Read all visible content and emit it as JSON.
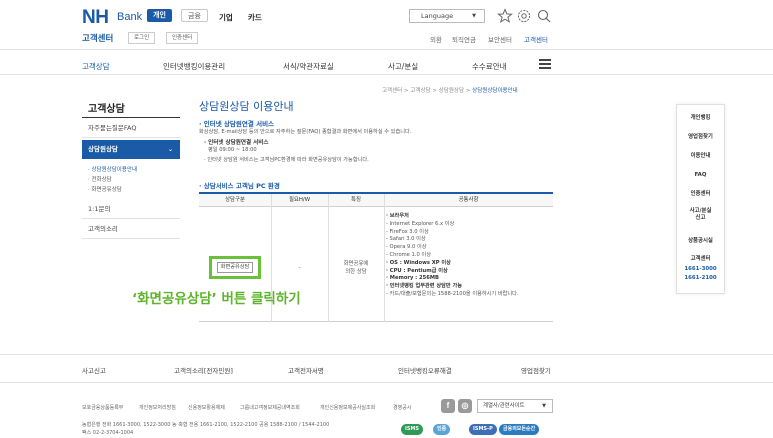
{
  "header": {
    "logo_nh": "NH",
    "logo_bank": "Bank",
    "segments": [
      "개인",
      "금융"
    ],
    "nav": [
      "기업",
      "카드"
    ],
    "language": "Language",
    "center_title": "고객센터",
    "login_btn": "로그인",
    "cert_btn": "인증센터",
    "top_links": [
      "외환",
      "퇴직연금",
      "보안센터",
      "고객센터"
    ]
  },
  "gnb": [
    "고객상담",
    "인터넷뱅킹이용관리",
    "서식/약관자료실",
    "사고/분실",
    "수수료안내"
  ],
  "breadcrumb": [
    "고객센터",
    "고객상담",
    "상담원상담",
    "상담원상담이용안내"
  ],
  "lnb": {
    "title": "고객상담",
    "items": [
      "자주묻는질문FAQ",
      "상담원상담",
      "1:1문의",
      "고객의소리"
    ],
    "subitems": [
      "상담원상담이용안내",
      "전화상담",
      "화면공유상담"
    ]
  },
  "main": {
    "title": "상담원상담 이용안내",
    "sec1": "인터넷 상담원연결 서비스",
    "sec1_desc": "화상상담, E-mail상담 등의 안으로 자주하는 질문(FAQ) 종합결과 화면에서 이용하실 수 있습니다.",
    "sec1_sub_title": "인터넷 상담원연결 서비스",
    "sec1_sub_hours": "평일 09:00 ~ 18:00",
    "sec1_note": "인터넷 상담원 서비스는 고객님PC환경에 따라 화면공유상담이 가능합니다.",
    "sec2": "상담서비스 고객님 PC 환경",
    "table_headers": [
      "상담구분",
      "필요H/W",
      "특징",
      "공통사항"
    ],
    "share_button": "화면공유상담",
    "hw": "-",
    "feature": "화면공유에\n의한 상담",
    "spec_lines": [
      "· 브라우저",
      "  - Internet Explorer 6.x 이상",
      "  - FireFox 3.0 이상",
      "  - Safari 3.0 이상",
      "  - Opera 9.0 이상",
      "  - Chrome 1.0 이상",
      "· OS : Windows XP 이상",
      "· CPU : Pentium급 이상",
      "· Memory : 256MB",
      "· 인터넷뱅킹 업무관련 상담만 가능",
      "  - 카드/대출/보험문의는 1588-2100을 이용하시기 바랍니다."
    ],
    "callout": "‘화면공유상담’ 버튼 클릭하기"
  },
  "quick_menu": [
    "개인뱅킹",
    "영업점찾기",
    "이용안내",
    "FAQ",
    "인증센터",
    "사고/분실\n신고",
    "상품공시실",
    "고객센터",
    "1661-3000",
    "1661-2100"
  ],
  "footer": {
    "nav": [
      "사고신고",
      "고객의소리[전자민원]",
      "고객전자서명",
      "인터넷뱅킹오류해결",
      "영업점찾기"
    ],
    "links": [
      "보호금융상품등록부",
      "개인정보처리방침",
      "신용정보활용체제",
      "그룹내고객정보제공내역조회",
      "개인신용정보제공사실조회",
      "경영공시"
    ],
    "site_select": "계열사/관련사이트",
    "info_line1": "농협은행 전화 1661-3000, 1522-3000   농 축협 전용 1661-2100, 1522-2100   공용 1588-2100 / 1544-2100",
    "info_line2": "팩스 02-2-3704-1004",
    "badges": [
      "ISMS",
      "인증",
      "ISMS-P",
      "금융의모든순간"
    ]
  },
  "colors": {
    "brand": "#1a5aa6",
    "highlight": "#6ac03a"
  }
}
